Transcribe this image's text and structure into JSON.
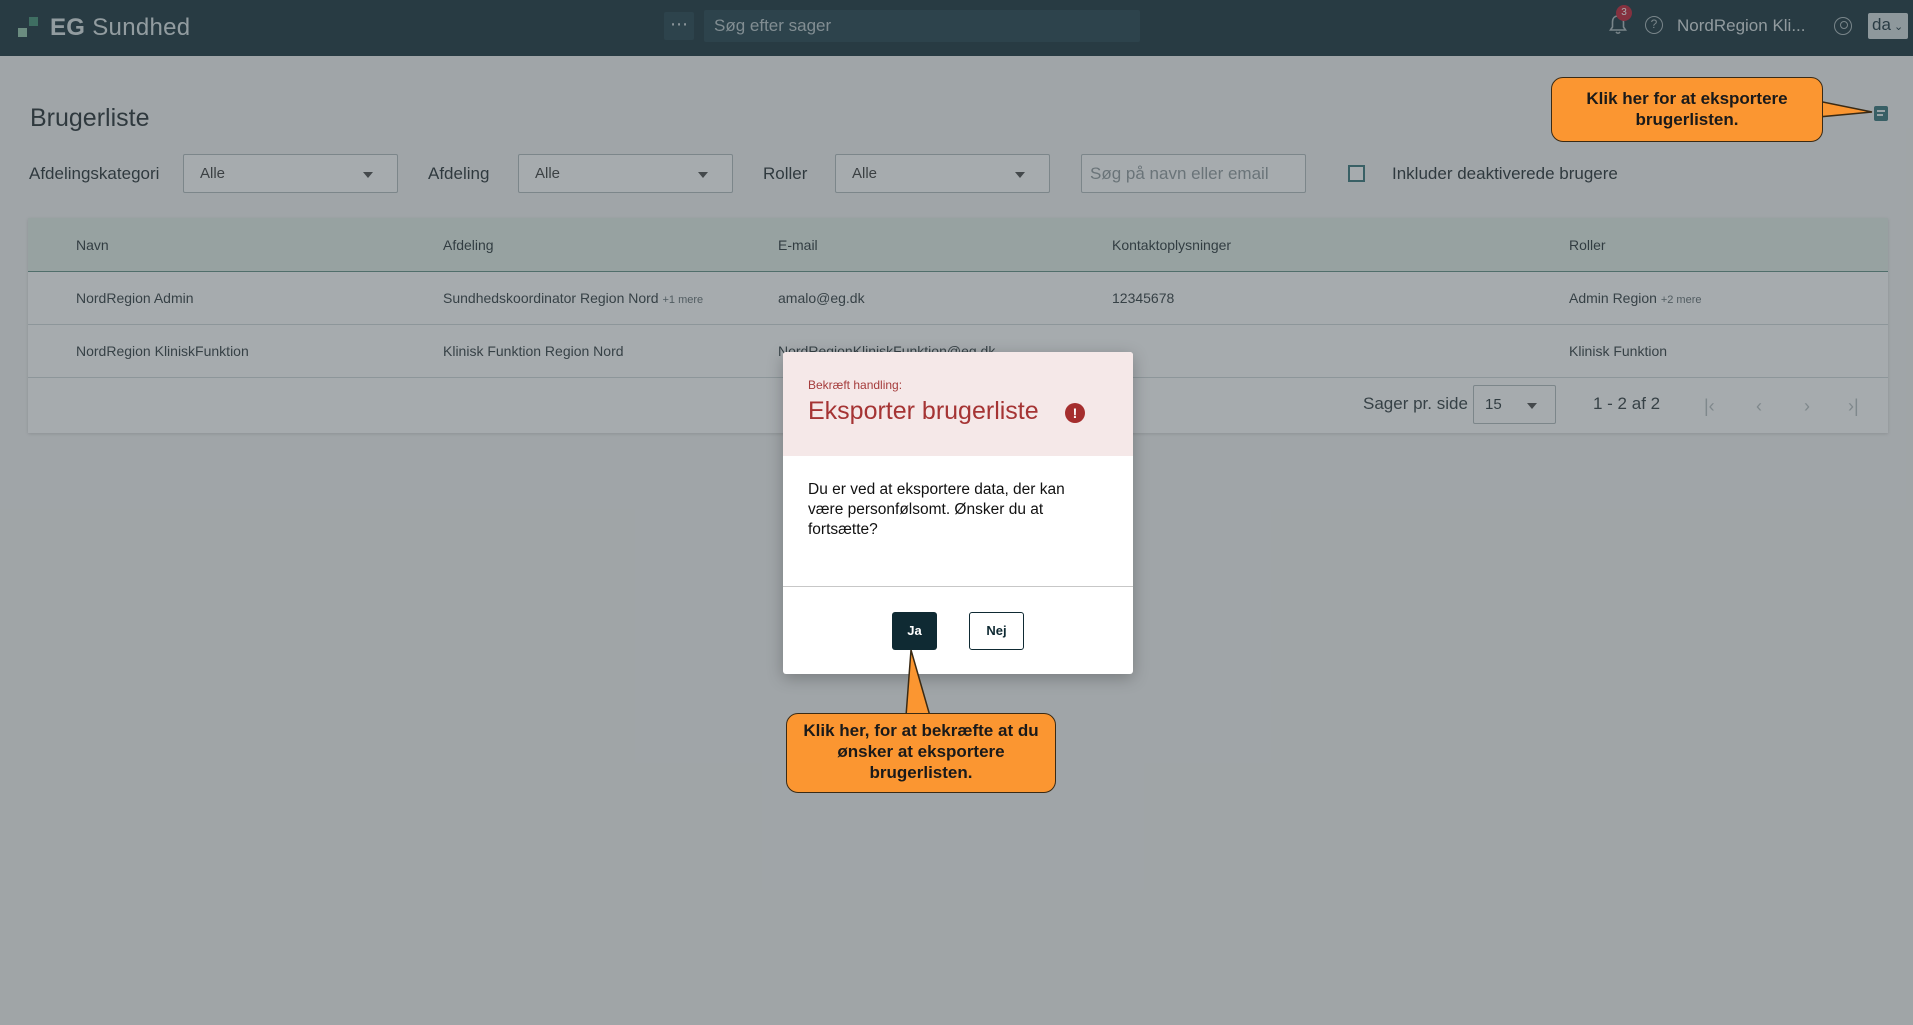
{
  "topbar": {
    "logo_bold": "EG",
    "logo_text": "Sundhed",
    "more_label": "⋯",
    "search_placeholder": "Søg efter sager",
    "notification_count": "3",
    "help_label": "?",
    "user_name": "NordRegion Kli...",
    "language": "da"
  },
  "page": {
    "title": "Brugerliste"
  },
  "filters": {
    "category_label": "Afdelingskategori",
    "category_value": "Alle",
    "department_label": "Afdeling",
    "department_value": "Alle",
    "roles_label": "Roller",
    "roles_value": "Alle",
    "search_placeholder": "Søg på navn eller email",
    "include_deactivated_label": "Inkluder deaktiverede brugere"
  },
  "table": {
    "columns": [
      "Navn",
      "Afdeling",
      "E-mail",
      "Kontaktoplysninger",
      "Roller"
    ],
    "rows": [
      {
        "name": "NordRegion Admin",
        "department": "Sundhedskoordinator Region Nord",
        "department_more": "+1 mere",
        "email": "amalo@eg.dk",
        "contact": "12345678",
        "roles": "Admin Region",
        "roles_more": "+2 mere"
      },
      {
        "name": "NordRegion KliniskFunktion",
        "department": "Klinisk Funktion Region Nord",
        "department_more": "",
        "email": "NordRegionKliniskFunktion@eg.dk",
        "contact": "",
        "roles": "Klinisk Funktion",
        "roles_more": ""
      }
    ]
  },
  "pager": {
    "per_page_label": "Sager pr. side",
    "per_page_value": "15",
    "range": "1 - 2 af 2",
    "first": "|‹",
    "prev": "‹",
    "next": "›",
    "last": "›|"
  },
  "modal": {
    "kicker": "Bekræft handling:",
    "title": "Eksporter brugerliste",
    "alert_icon": "!",
    "body": "Du er ved at eksportere data, der kan være personfølsomt. Ønsker du at fortsætte?",
    "yes_label": "Ja",
    "no_label": "Nej"
  },
  "callouts": {
    "export_hint": "Klik her for at eksportere brugerlisten.",
    "confirm_hint": "Klik her, for at bekræfte at du ønsker at eksportere brugerlisten."
  },
  "colors": {
    "topbar": "#0f2a33",
    "accent": "#2c6e73",
    "danger": "#a53434",
    "callout": "#fb9631"
  }
}
